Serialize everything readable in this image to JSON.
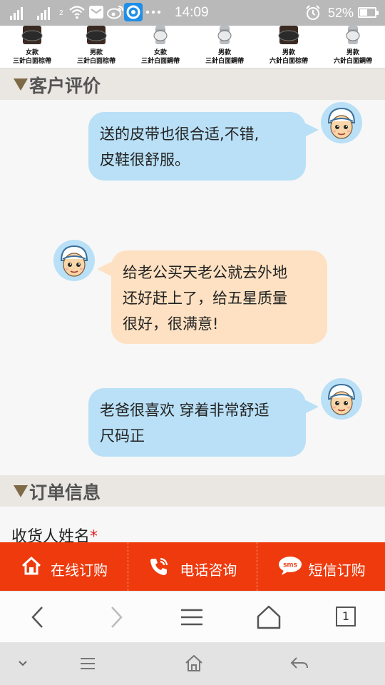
{
  "status_bar": {
    "network_label": "2",
    "time": "14:09",
    "battery_percent": "52%",
    "battery_level": 0.52,
    "icons": [
      "signal-icon",
      "signal-icon",
      "wifi-icon",
      "mail-icon",
      "weibo-icon",
      "browser-app-icon",
      "more-icon",
      "alarm-icon",
      "battery-icon"
    ]
  },
  "products": [
    {
      "line1": "女款",
      "line2": "三針白面棕帶",
      "band": "brown"
    },
    {
      "line1": "男款",
      "line2": "三針白面棕帶",
      "band": "brown"
    },
    {
      "line1": "女款",
      "line2": "三針白面鋼帶",
      "band": "steel"
    },
    {
      "line1": "男款",
      "line2": "三針白面鋼帶",
      "band": "steel"
    },
    {
      "line1": "男款",
      "line2": "六針白面棕帶",
      "band": "brown"
    },
    {
      "line1": "男款",
      "line2": "六針白面鋼帶",
      "band": "steel"
    }
  ],
  "reviews_section": {
    "title": "客户评价"
  },
  "reviews": [
    {
      "line1": "送的皮带也很合适,不错,",
      "line2": "皮鞋很舒服。",
      "side": "right"
    },
    {
      "line1": "给老公买天老公就去外地",
      "line2": "还好赶上了，给五星质量",
      "line3": "很好，很满意!",
      "side": "left"
    },
    {
      "line1": "老爸很喜欢 穿着非常舒适",
      "line2": "尺码正",
      "side": "right"
    }
  ],
  "order_section": {
    "title": "订单信息",
    "first_field_label": "收货人姓名",
    "required_mark": "*"
  },
  "action_bar": {
    "online_order": "在线订购",
    "phone_consult": "电话咨询",
    "sms_order": "短信订购",
    "sms_badge": "sms",
    "color": "#ee3a0d"
  },
  "browser_bar": {
    "tab_count": "1"
  },
  "colors": {
    "bubble_blue": "#b9e0f6",
    "bubble_peach": "#fde1c2",
    "section_bg": "#eae6e1",
    "triangle": "#7e6a47"
  }
}
